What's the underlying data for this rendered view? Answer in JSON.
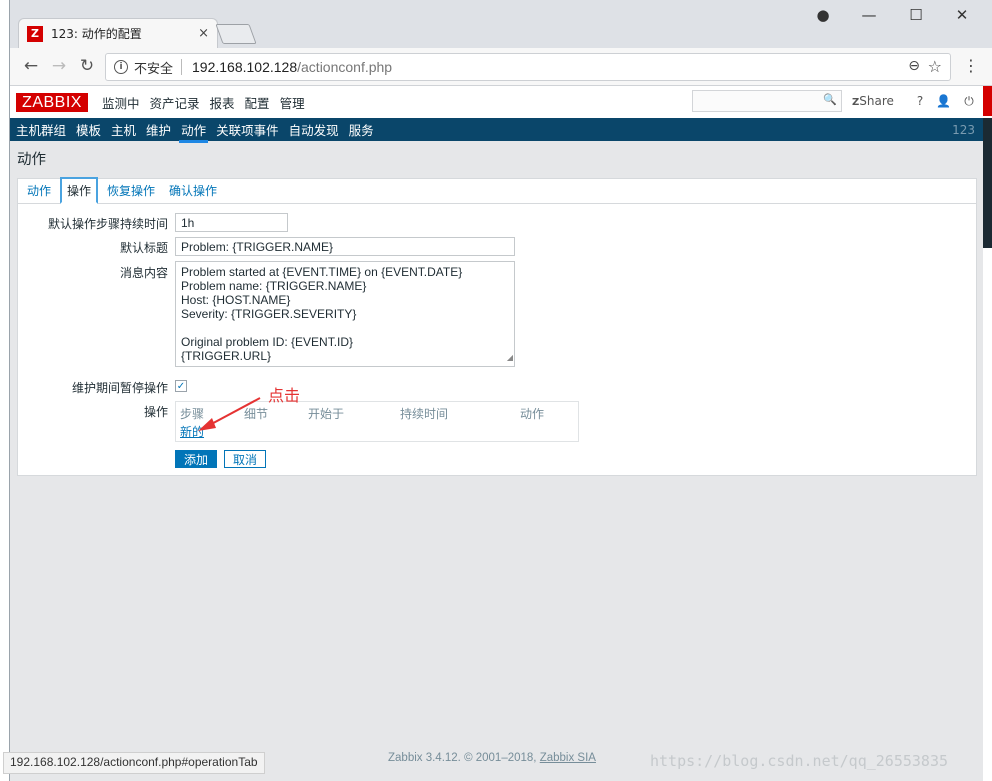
{
  "browser": {
    "tab_title": "123: 动作的配置",
    "tab_close": "×",
    "insecure_label": "不安全",
    "url_host": "192.168.102.128",
    "url_path": "/actionconf.php",
    "status_url": "192.168.102.128/actionconf.php#operationTab"
  },
  "header": {
    "logo": "ZABBIX",
    "menu": [
      "监测中",
      "资产记录",
      "报表",
      "配置",
      "管理"
    ],
    "share_label": "Share",
    "share_prefix": "Z"
  },
  "subnav": {
    "items": [
      "主机群组",
      "模板",
      "主机",
      "维护",
      "动作",
      "关联项事件",
      "自动发现",
      "服务"
    ],
    "active_index": 4,
    "node_name": "123"
  },
  "page": {
    "title": "动作",
    "tabs": [
      "动作",
      "操作",
      "恢复操作",
      "确认操作"
    ],
    "active_tab": 1
  },
  "form": {
    "step_duration_label": "默认操作步骤持续时间",
    "step_duration_value": "1h",
    "subject_label": "默认标题",
    "subject_value": "Problem: {TRIGGER.NAME}",
    "message_label": "消息内容",
    "message_value": "Problem started at {EVENT.TIME} on {EVENT.DATE}\nProblem name: {TRIGGER.NAME}\nHost: {HOST.NAME}\nSeverity: {TRIGGER.SEVERITY}\n\nOriginal problem ID: {EVENT.ID}\n{TRIGGER.URL}",
    "pause_label": "维护期间暂停操作",
    "pause_checked": true,
    "operations_label": "操作",
    "op_columns": [
      "步骤",
      "细节",
      "开始于",
      "持续时间",
      "动作"
    ],
    "new_link": "新的",
    "add_button": "添加",
    "cancel_button": "取消"
  },
  "annotation": {
    "text": "点击",
    "color": "#e53333"
  },
  "footer": {
    "text": "Zabbix 3.4.12. © 2001–2018,",
    "company": "Zabbix SIA",
    "watermark": "https://blog.csdn.net/qq_26553835"
  },
  "colors": {
    "brand_red": "#d40000",
    "nav_bg": "#0a466a",
    "link_blue": "#0275b8"
  }
}
